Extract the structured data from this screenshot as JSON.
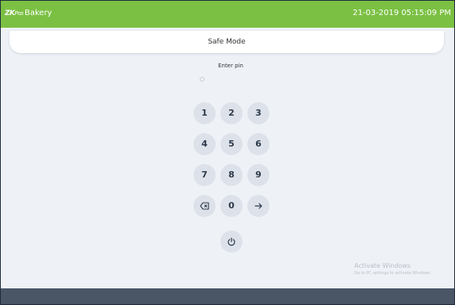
{
  "topbar": {
    "logo_text": "ZK",
    "logo_sub": "Pos",
    "app_name": "Bakery",
    "datetime": "21-03-2019  05:15:09 PM",
    "bar_color": "#7bc043"
  },
  "title": "Safe Mode",
  "prompt": "Enter pin",
  "keypad": {
    "keys": [
      "1",
      "2",
      "3",
      "4",
      "5",
      "6",
      "7",
      "8",
      "9",
      "0"
    ],
    "icons": {
      "backspace": "backspace-icon",
      "enter": "arrow-right-icon",
      "power": "power-icon"
    }
  },
  "watermark": {
    "title": "Activate Windows",
    "subtitle": "Go to PC settings to activate Windows."
  }
}
